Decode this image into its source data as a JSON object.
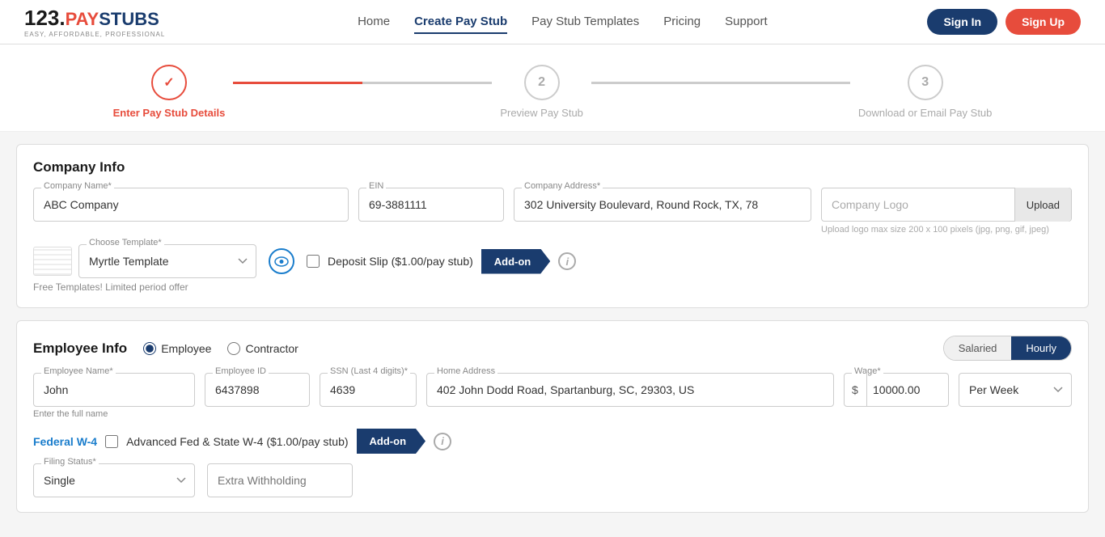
{
  "header": {
    "logo": {
      "number": "123.",
      "pay": "PAY",
      "stubs": "STUBS",
      "tagline": "EASY, AFFORDABLE, PROFESSIONAL"
    },
    "nav": [
      {
        "label": "Home",
        "active": false
      },
      {
        "label": "Create Pay Stub",
        "active": true
      },
      {
        "label": "Pay Stub Templates",
        "active": false
      },
      {
        "label": "Pricing",
        "active": false
      },
      {
        "label": "Support",
        "active": false
      }
    ],
    "signin_label": "Sign In",
    "signup_label": "Sign Up"
  },
  "steps": [
    {
      "number": "✓",
      "label": "Enter Pay Stub Details",
      "active": true
    },
    {
      "number": "2",
      "label": "Preview Pay Stub",
      "active": false
    },
    {
      "number": "3",
      "label": "Download or Email Pay Stub",
      "active": false
    }
  ],
  "company_info": {
    "title": "Company Info",
    "company_name_label": "Company Name*",
    "company_name_value": "ABC Company",
    "ein_label": "EIN",
    "ein_value": "69-3881111",
    "address_label": "Company Address*",
    "address_value": "302 University Boulevard, Round Rock, TX, 78",
    "logo_label": "Company Logo Upload",
    "logo_placeholder": "Company Logo",
    "upload_btn": "Upload",
    "upload_hint": "Upload logo max size 200 x 100 pixels (jpg, png, gif, jpeg)",
    "template_label": "Choose Template*",
    "template_value": "Myrtle Template",
    "free_offer": "Free Templates! Limited period offer",
    "deposit_label": "Deposit Slip ($1.00/pay stub)",
    "addon_btn": "Add-on"
  },
  "employee_info": {
    "title": "Employee Info",
    "employee_radio": "Employee",
    "contractor_radio": "Contractor",
    "salaried_btn": "Salaried",
    "hourly_btn": "Hourly",
    "emp_name_label": "Employee Name*",
    "emp_name_value": "John",
    "emp_name_hint": "Enter the full name",
    "emp_id_label": "Employee ID",
    "emp_id_value": "6437898",
    "ssn_label": "SSN (Last 4 digits)*",
    "ssn_value": "4639",
    "address_label": "Home Address",
    "address_value": "402 John Dodd Road, Spartanburg, SC, 29303, US",
    "wage_label": "Wage*",
    "wage_symbol": "$",
    "wage_value": "10000.00",
    "per_week_value": "Per Week",
    "federal_label": "Federal W-4",
    "advanced_label": "Advanced Fed & State W-4 ($1.00/pay stub)",
    "addon_btn": "Add-on",
    "filing_status_label": "Filing Status*",
    "filing_status_value": "Single",
    "extra_withholding_placeholder": "Extra Withholding"
  }
}
